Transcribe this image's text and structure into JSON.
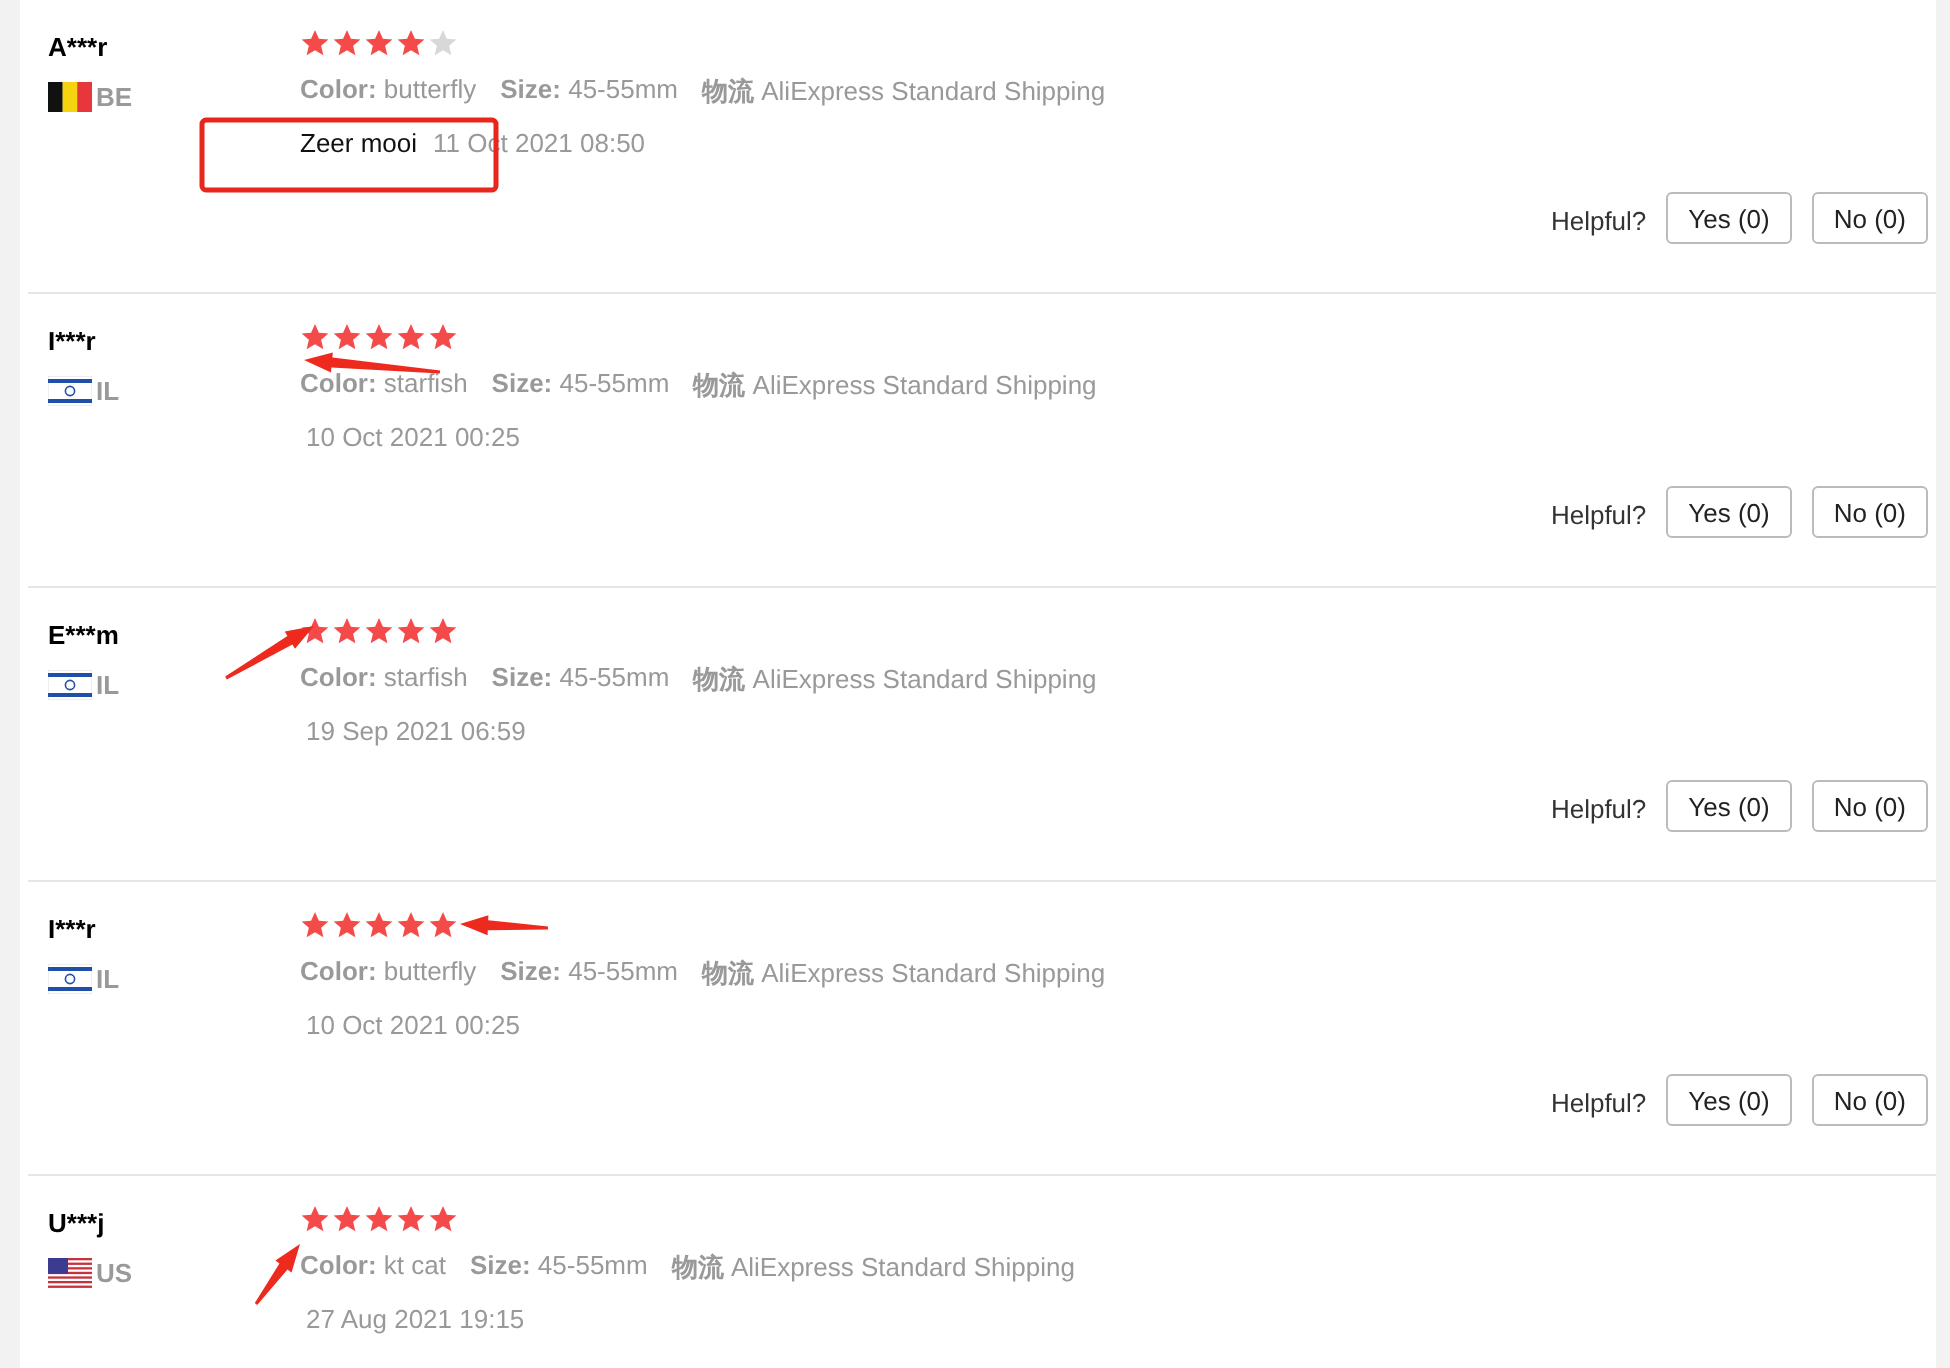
{
  "reviews": [
    {
      "name": "A***r",
      "kind": "belgium",
      "country": "BE",
      "stars": 4,
      "color_label": "Color:",
      "variant": "butterfly",
      "size_label": "Size:",
      "size": "45-55mm",
      "shipping_label": "物流",
      "shipping": "AliExpress Standard Shipping",
      "comment": "Zeer mooi",
      "date": "11 Oct 2021 08:50",
      "helpful": "Helpful?",
      "yes": "Yes (0)",
      "no": "No (0)"
    },
    {
      "name": "I***r",
      "kind": "israel",
      "country": "IL",
      "stars": 5,
      "color_label": "Color:",
      "variant": "starfish",
      "size_label": "Size:",
      "size": "45-55mm",
      "shipping_label": "物流",
      "shipping": "AliExpress Standard Shipping",
      "date": "10 Oct 2021 00:25",
      "helpful": "Helpful?",
      "yes": "Yes (0)",
      "no": "No (0)"
    },
    {
      "name": "E***m",
      "kind": "israel",
      "country": "IL",
      "stars": 5,
      "color_label": "Color:",
      "variant": "starfish",
      "size_label": "Size:",
      "size": "45-55mm",
      "shipping_label": "物流",
      "shipping": "AliExpress Standard Shipping",
      "date": "19 Sep 2021 06:59",
      "helpful": "Helpful?",
      "yes": "Yes (0)",
      "no": "No (0)"
    },
    {
      "name": "I***r",
      "kind": "israel",
      "country": "IL",
      "stars": 5,
      "color_label": "Color:",
      "variant": "butterfly",
      "size_label": "Size:",
      "size": "45-55mm",
      "shipping_label": "物流",
      "shipping": "AliExpress Standard Shipping",
      "date": "10 Oct 2021 00:25",
      "helpful": "Helpful?",
      "yes": "Yes (0)",
      "no": "No (0)"
    },
    {
      "name": "U***j",
      "kind": "usa",
      "country": "US",
      "stars": 5,
      "color_label": "Color:",
      "variant": "kt cat",
      "size_label": "Size:",
      "size": "45-55mm",
      "shipping_label": "物流",
      "shipping": "AliExpress Standard Shipping",
      "date": "27 Aug 2021 19:15"
    }
  ]
}
